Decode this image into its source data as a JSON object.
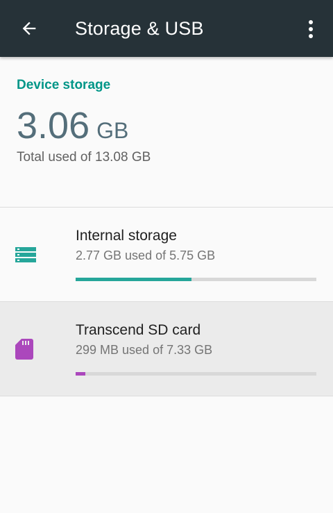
{
  "appbar": {
    "title": "Storage & USB",
    "back_icon": "arrow-back-icon",
    "overflow_icon": "more-vert-icon",
    "bg_color": "#263238"
  },
  "device_storage": {
    "header": "Device storage",
    "used_value": "3.06",
    "used_unit": "GB",
    "total_text": "Total used of 13.08 GB",
    "accent_color": "#009688"
  },
  "volumes": [
    {
      "title": "Internal storage",
      "subtitle": "2.77 GB used of 5.75 GB",
      "icon": "storage-icon",
      "color": "#26a69a",
      "used_fraction": 0.48
    },
    {
      "title": "Transcend SD card",
      "subtitle": "299 MB used of 7.33 GB",
      "icon": "sd-card-icon",
      "color": "#ab47bc",
      "used_fraction": 0.04
    }
  ]
}
